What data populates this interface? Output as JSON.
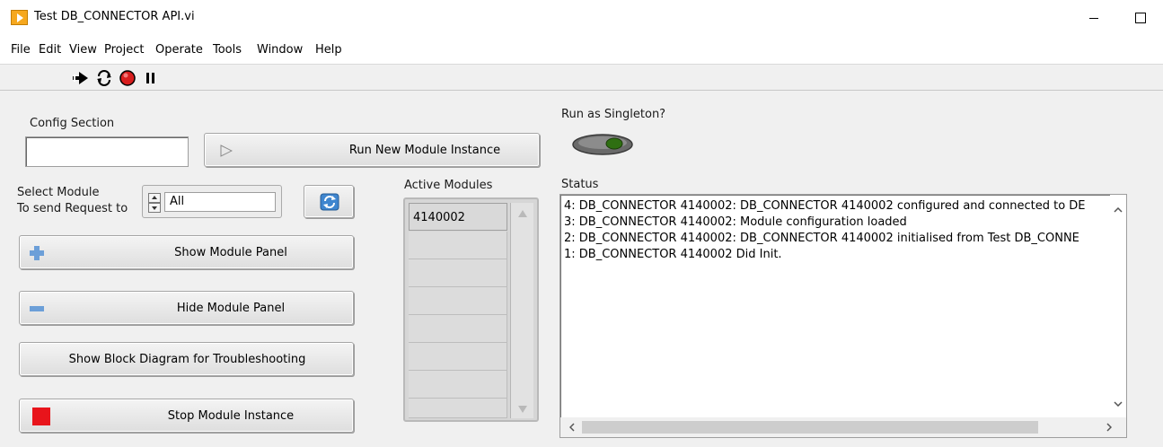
{
  "window": {
    "title": "Test DB_CONNECTOR API.vi"
  },
  "menu": [
    "File",
    "Edit",
    "View",
    "Project",
    "Operate",
    "Tools",
    "Window",
    "Help"
  ],
  "toolbar": {
    "icons": [
      "run-arrow-icon",
      "run-continuously-icon",
      "abort-icon",
      "pause-icon"
    ]
  },
  "panel": {
    "config_section_label": "Config Section",
    "config_section_value": "",
    "run_new_button": "Run New Module Instance",
    "run_singleton_label": "Run as Singleton?",
    "select_module_label_line1": "Select Module",
    "select_module_label_line2": "To send Request to",
    "select_module_value": "All",
    "show_panel_button": "Show Module Panel",
    "hide_panel_button": "Hide Module Panel",
    "show_block_diagram_button": "Show Block Diagram for Troubleshooting",
    "stop_button": "Stop Module Instance",
    "active_modules_label": "Active Modules",
    "active_modules": [
      "4140002",
      "",
      "",
      "",
      "",
      "",
      "",
      ""
    ],
    "status_label": "Status",
    "status_lines": [
      "4: DB_CONNECTOR 4140002: DB_CONNECTOR 4140002 configured and connected to DE",
      "3: DB_CONNECTOR 4140002: Module configuration loaded",
      "2: DB_CONNECTOR 4140002: DB_CONNECTOR 4140002 initialised from Test DB_CONNE",
      "1: DB_CONNECTOR 4140002 Did Init."
    ]
  },
  "colors": {
    "stop_red": "#e8141b",
    "plus_blue": "#6c9fd8",
    "boolean_led_green": "#2f6f12"
  }
}
